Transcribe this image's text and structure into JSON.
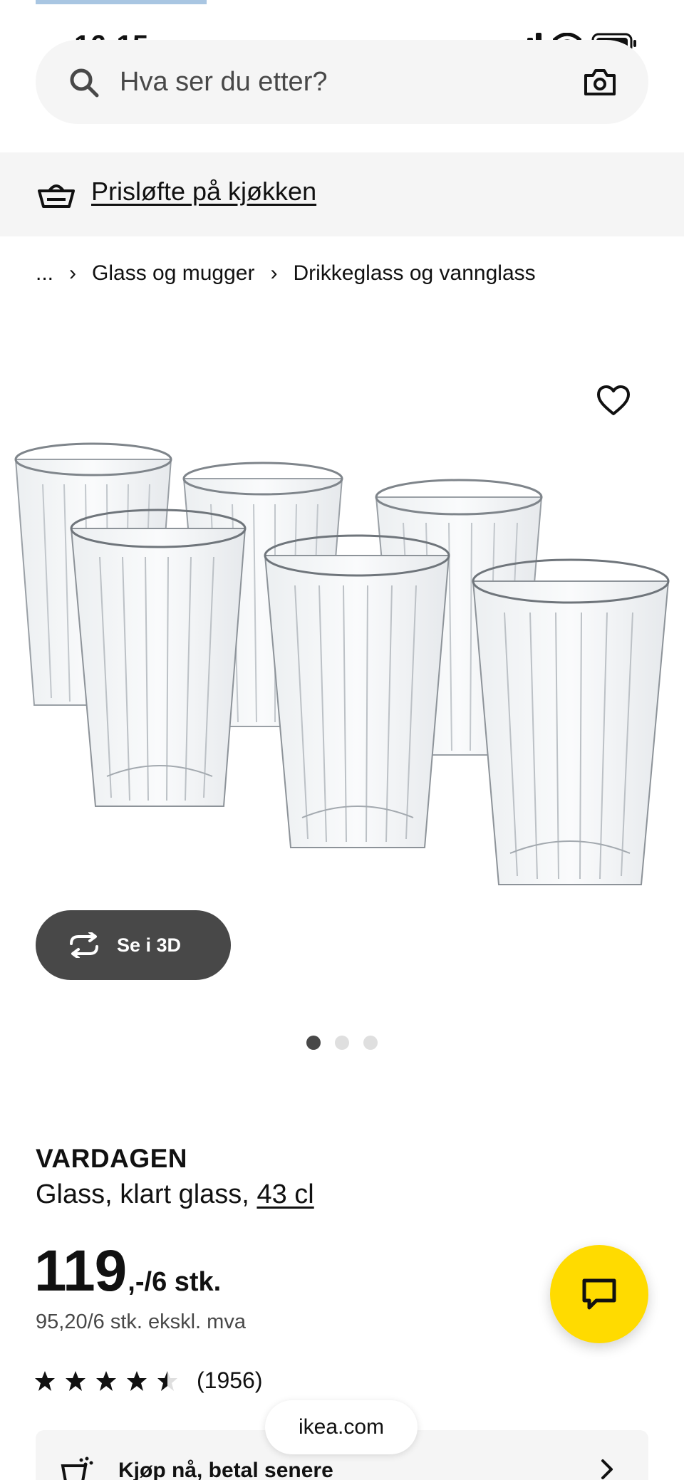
{
  "status_bar": {
    "time": "16:15"
  },
  "search": {
    "placeholder": "Hva ser du etter?"
  },
  "promo": {
    "label": "Prisløfte på kjøkken"
  },
  "breadcrumb": {
    "ellipsis": "...",
    "items": [
      "Glass og mugger",
      "Drikkeglass og vannglass"
    ]
  },
  "gallery": {
    "button_3d_label": "Se i 3D",
    "dot_count": 3,
    "active_dot": 0
  },
  "product": {
    "name": "VARDAGEN",
    "description": "Glass, klart glass,",
    "size": "43 cl",
    "price": "119",
    "price_suffix": ",-/6 stk.",
    "price_ex_vat": "95,20/6 stk. ekskl. mva",
    "rating": 4.5,
    "rating_count": "(1956)"
  },
  "klarna": {
    "label": "Kjøp nå, betal senere"
  },
  "browser": {
    "url": "ikea.com"
  },
  "colors": {
    "accent_yellow": "#ffdb00",
    "dark_gray": "#484848",
    "light_gray": "#f5f5f5"
  },
  "icons": [
    "signal-icon",
    "wifi-icon",
    "battery-icon",
    "search-icon",
    "camera-icon",
    "basket-icon",
    "chevron-right-icon",
    "heart-icon",
    "rotate-3d-icon",
    "star-icon",
    "chat-icon"
  ]
}
